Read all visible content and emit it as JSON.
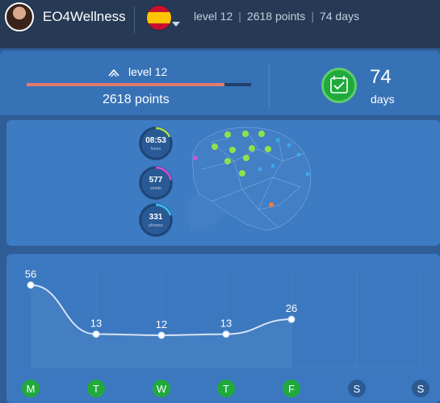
{
  "topbar": {
    "username": "EO4Wellness",
    "stats": [
      "level 12",
      "2618 points",
      "74 days"
    ]
  },
  "level_card": {
    "level_label": "level 12",
    "progress": 0.88,
    "points_label": "2618 points",
    "days_value": "74",
    "days_label": "days"
  },
  "brain": {
    "stats": [
      {
        "value": "08:53",
        "unit": "hours",
        "color": "#a8e04a",
        "fraction": 0.18
      },
      {
        "value": "577",
        "unit": "words",
        "color": "#d44fd0",
        "fraction": 0.22
      },
      {
        "value": "331",
        "unit": "phrases",
        "color": "#39c3f0",
        "fraction": 0.2
      }
    ]
  },
  "colors": {
    "active_day": "#1faa3b",
    "inactive_day": "#2c5a93",
    "line": "#d6e4f5",
    "accent_progress": "#e47b6c"
  },
  "chart_data": {
    "type": "line",
    "categories": [
      "M",
      "T",
      "W",
      "T",
      "F",
      "S",
      "S"
    ],
    "values": [
      56,
      13,
      12,
      13,
      26,
      null,
      null
    ],
    "active": [
      true,
      true,
      true,
      true,
      true,
      false,
      false
    ],
    "ylim": [
      0,
      60
    ]
  }
}
